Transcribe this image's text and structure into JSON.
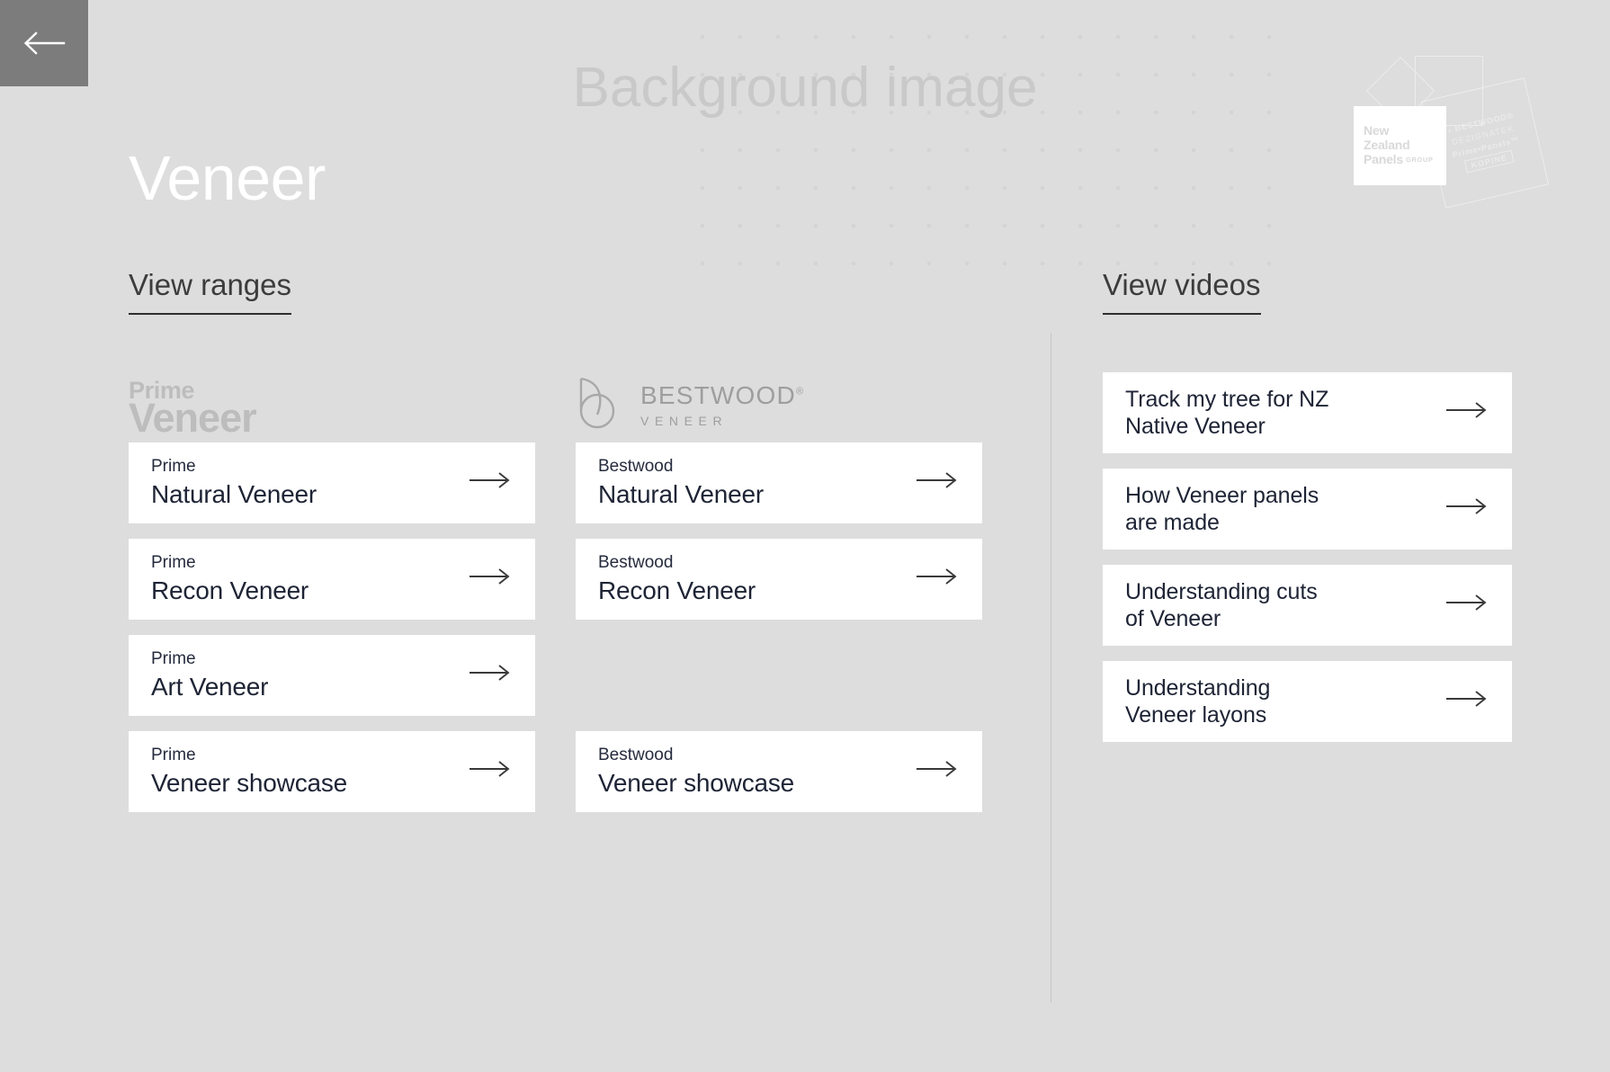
{
  "background": {
    "placeholder_text": "Background image",
    "page_bg_color": "#dddddd",
    "card_bg_color": "#ffffff"
  },
  "back_button": {
    "icon": "arrow-left-icon",
    "bg_color": "#7c7c7c"
  },
  "page_title": "Veneer",
  "logo_cluster": {
    "company_name_lines": [
      "New",
      "Zealand",
      "Panels"
    ],
    "company_suffix": "GROUP",
    "brands": [
      {
        "name": "BESTWOOD",
        "mark": "®",
        "style": "bold"
      },
      {
        "name": "DEZIGNATEK",
        "mark": "",
        "style": "thin"
      },
      {
        "name": "Prime•Panels",
        "mark": "™",
        "style": "bold"
      },
      {
        "name": "KOPINE",
        "mark": "",
        "style": "boxed"
      }
    ]
  },
  "ranges_section": {
    "heading": "View ranges",
    "brand_columns": [
      {
        "logo": {
          "type": "prime-veneer-logo",
          "line1": "Prime",
          "line2": "Veneer"
        },
        "cards": [
          {
            "eyebrow": "Prime",
            "title": "Natural Veneer",
            "arrow": "arrow-right-icon",
            "empty": false
          },
          {
            "eyebrow": "Prime",
            "title": "Recon Veneer",
            "arrow": "arrow-right-icon",
            "empty": false
          },
          {
            "eyebrow": "Prime",
            "title": "Art Veneer",
            "arrow": "arrow-right-icon",
            "empty": false
          },
          {
            "eyebrow": "Prime",
            "title": "Veneer showcase",
            "arrow": "arrow-right-icon",
            "empty": false
          }
        ]
      },
      {
        "logo": {
          "type": "bestwood-veneer-logo",
          "line1": "BESTWOOD",
          "registered": "®",
          "line2": "VENEER"
        },
        "cards": [
          {
            "eyebrow": "Bestwood",
            "title": "Natural Veneer",
            "arrow": "arrow-right-icon",
            "empty": false
          },
          {
            "eyebrow": "Bestwood",
            "title": "Recon Veneer",
            "arrow": "arrow-right-icon",
            "empty": false
          },
          {
            "eyebrow": "",
            "title": "",
            "arrow": "",
            "empty": true
          },
          {
            "eyebrow": "Bestwood",
            "title": "Veneer showcase",
            "arrow": "arrow-right-icon",
            "empty": false
          }
        ]
      }
    ]
  },
  "videos_section": {
    "heading": "View videos",
    "cards": [
      {
        "title": "Track my tree for NZ\nNative Veneer",
        "arrow": "arrow-right-icon"
      },
      {
        "title": "How Veneer panels\nare made",
        "arrow": "arrow-right-icon"
      },
      {
        "title": "Understanding cuts\nof Veneer",
        "arrow": "arrow-right-icon"
      },
      {
        "title": "Understanding\nVeneer layons",
        "arrow": "arrow-right-icon"
      }
    ]
  }
}
